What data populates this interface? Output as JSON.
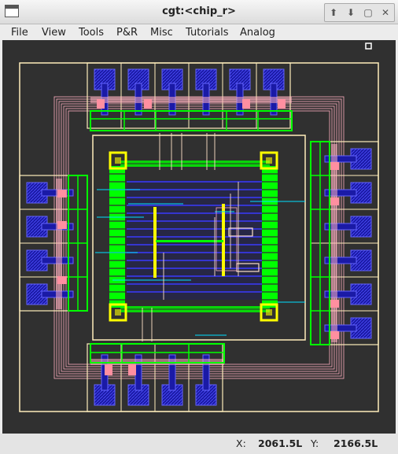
{
  "window": {
    "title": "cgt:<chip_r>"
  },
  "window_buttons": {
    "up": "⬆",
    "down": "⬇",
    "maximize": "▢",
    "close": "✕"
  },
  "menu": [
    "File",
    "View",
    "Tools",
    "P&R",
    "Misc",
    "Tutorials",
    "Analog"
  ],
  "status": {
    "x_label": "X:",
    "x_value": "2061.5L",
    "y_label": "Y:",
    "y_value": "2166.5L"
  },
  "colors": {
    "background": "#303030",
    "outline": "#ffeebb",
    "pad": "#1a1aa6",
    "route": "#ffb0c0",
    "highlight": "#ffff00",
    "cell": "#00ff00",
    "metal": "#3a3aff",
    "poly": "#00e0ff"
  }
}
